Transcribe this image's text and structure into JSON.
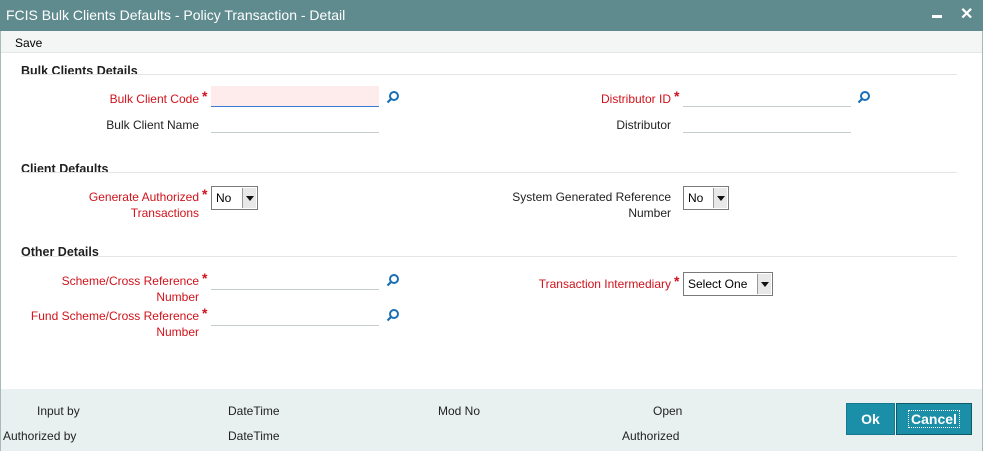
{
  "window": {
    "title": "FCIS Bulk Clients Defaults - Policy Transaction - Detail"
  },
  "menu": {
    "save_label": "Save"
  },
  "sections": {
    "bulk_clients": "Bulk Clients Details",
    "client_defaults": "Client Defaults",
    "other_details": "Other Details"
  },
  "fields": {
    "bulk_client_code": {
      "label": "Bulk Client Code",
      "value": ""
    },
    "bulk_client_name": {
      "label": "Bulk Client Name",
      "value": ""
    },
    "distributor_id": {
      "label": "Distributor ID",
      "value": ""
    },
    "distributor": {
      "label": "Distributor",
      "value": ""
    },
    "generate_authorized": {
      "label_line1": "Generate Authorized",
      "label_line2": "Transactions",
      "value": "No"
    },
    "system_generated_ref": {
      "label_line1": "System Generated Reference",
      "label_line2": "Number",
      "value": "No"
    },
    "scheme_ref": {
      "label_line1": "Scheme/Cross Reference",
      "label_line2": "Number",
      "value": ""
    },
    "fund_scheme_ref": {
      "label_line1": "Fund Scheme/Cross Reference",
      "label_line2": "Number",
      "value": ""
    },
    "transaction_intermediary": {
      "label": "Transaction Intermediary",
      "value": "Select One"
    }
  },
  "required_marker": "*",
  "icons": {
    "lookup": "search-icon",
    "minimize": "minimize-icon",
    "close": "close-icon",
    "dropdown": "chevron-down-icon"
  },
  "footer": {
    "input_by": "Input by",
    "authorized_by": "Authorized by",
    "datetime_1": "DateTime",
    "datetime_2": "DateTime",
    "mod_no": "Mod No",
    "open": "Open",
    "authorized": "Authorized",
    "ok_label": "Ok",
    "cancel_label": "Cancel"
  },
  "colors": {
    "titlebar": "#5f8a8e",
    "required": "#d0121b",
    "button": "#1b8fa8",
    "footer_bg": "#e8f0f0"
  }
}
